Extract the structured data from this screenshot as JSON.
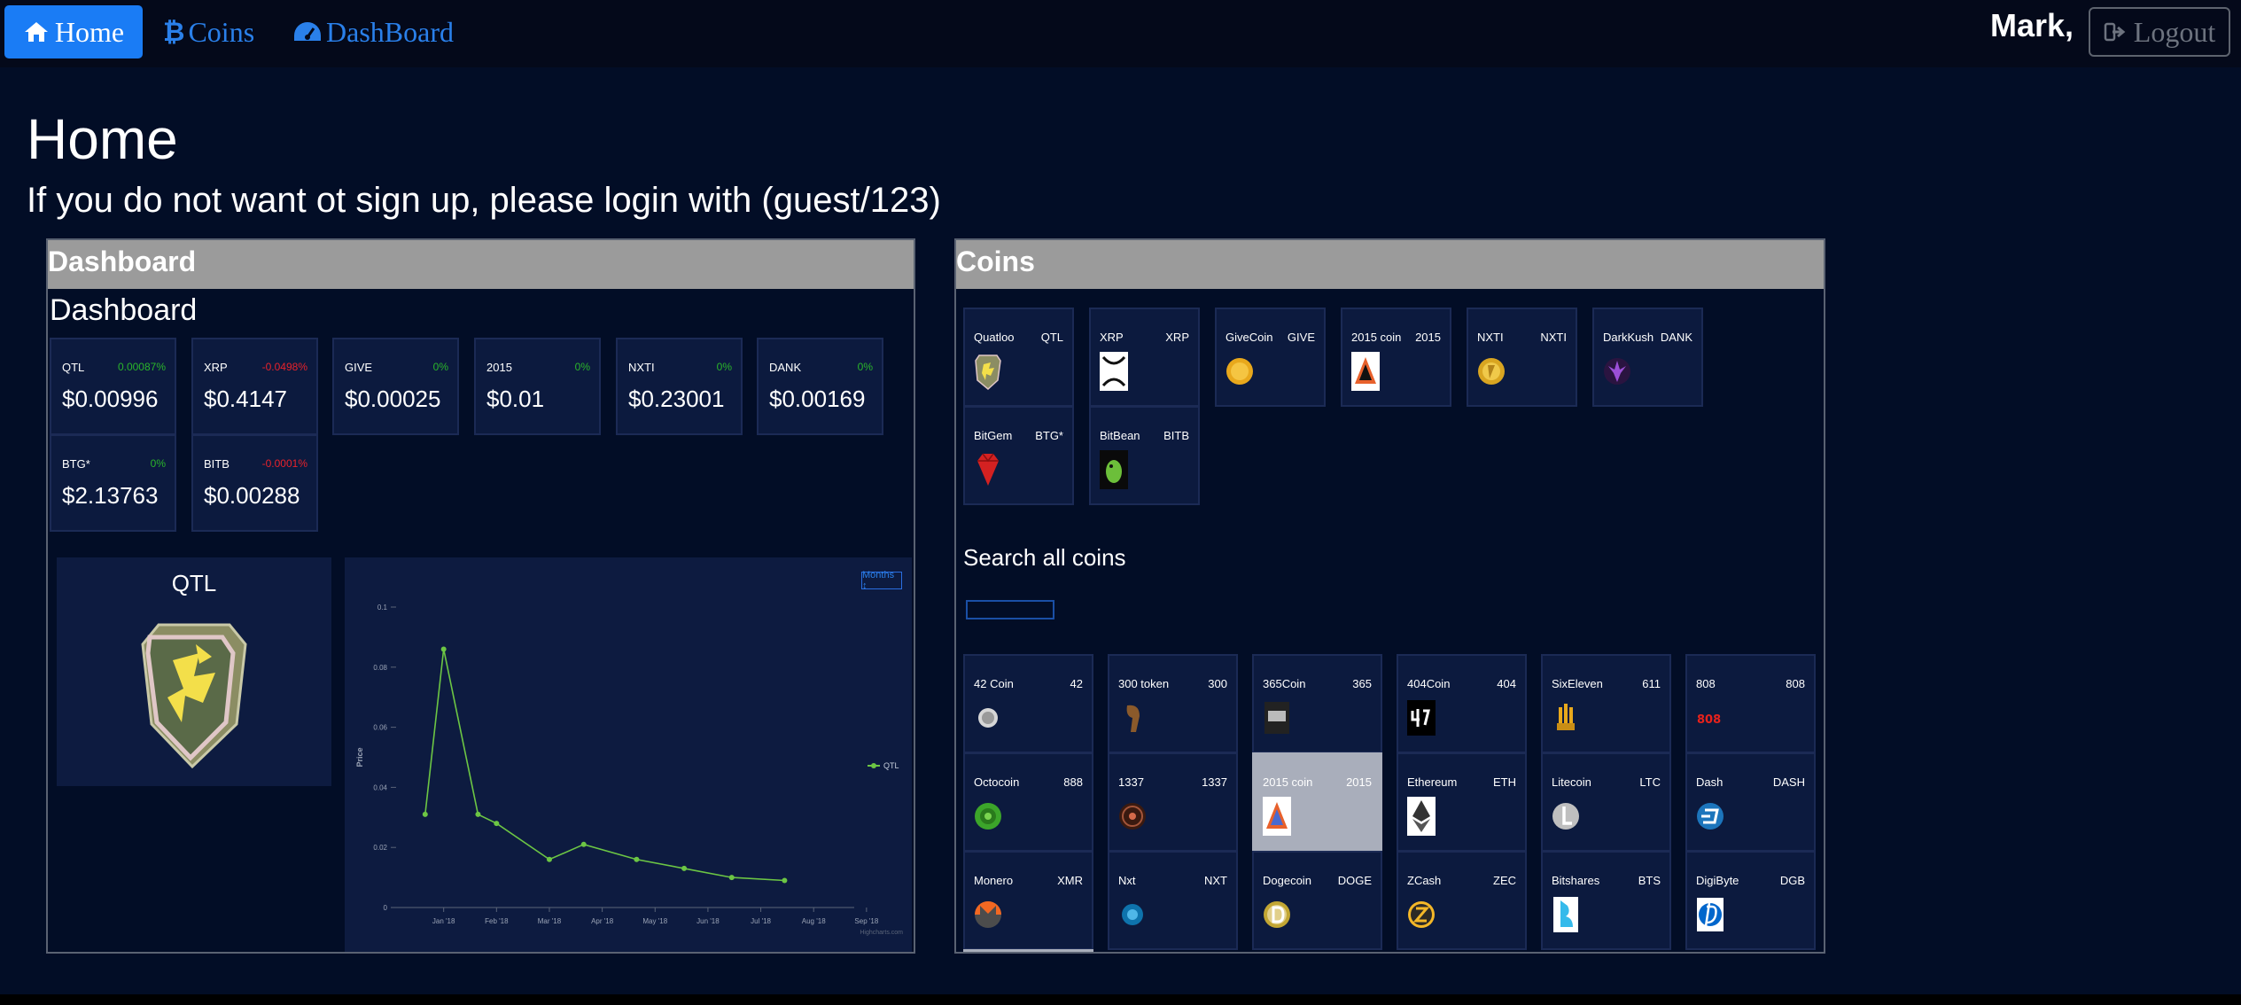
{
  "nav": {
    "home": "Home",
    "coins": "Coins",
    "dashboard": "DashBoard",
    "user": "Mark,",
    "logout": "Logout"
  },
  "page": {
    "title": "Home",
    "subtitle": "If you do not want ot sign up, please login with (guest/123)"
  },
  "dashboard_panel": {
    "header": "Dashboard",
    "subtitle": "Dashboard",
    "cards": [
      {
        "symbol": "QTL",
        "change": "0.00087%",
        "price": "$0.00996",
        "trend": "up"
      },
      {
        "symbol": "XRP",
        "change": "-0.0498%",
        "price": "$0.4147",
        "trend": "down"
      },
      {
        "symbol": "GIVE",
        "change": "0%",
        "price": "$0.00025",
        "trend": "up"
      },
      {
        "symbol": "2015",
        "change": "0%",
        "price": "$0.01",
        "trend": "up"
      },
      {
        "symbol": "NXTI",
        "change": "0%",
        "price": "$0.23001",
        "trend": "up"
      },
      {
        "symbol": "DANK",
        "change": "0%",
        "price": "$0.00169",
        "trend": "up"
      },
      {
        "symbol": "BTG*",
        "change": "0%",
        "price": "$2.13763",
        "trend": "up"
      },
      {
        "symbol": "BITB",
        "change": "-0.0001%",
        "price": "$0.00288",
        "trend": "down"
      }
    ],
    "selected_coin": "QTL",
    "months_button": "Months ↕"
  },
  "chart_data": {
    "type": "line",
    "x": [
      "Jan '18",
      "Feb '18",
      "Mar '18",
      "Apr '18",
      "May '18",
      "Jun '18",
      "Jul '18",
      "Aug '18",
      "Sep '18"
    ],
    "series": [
      {
        "name": "QTL",
        "x": [
          0.0,
          0.35,
          1.0,
          1.35,
          2.35,
          3.0,
          4.0,
          4.9,
          5.8,
          6.8
        ],
        "values": [
          0.031,
          0.086,
          0.031,
          0.028,
          0.016,
          0.021,
          0.016,
          0.013,
          0.01,
          0.009
        ]
      }
    ],
    "ylabel": "Price",
    "yticks": [
      "0",
      "0.02",
      "0.04",
      "0.06",
      "0.08",
      "0.1"
    ],
    "ylim": [
      0,
      0.1
    ],
    "legend": "right",
    "credit": "Highcharts.com",
    "color": "#6cc644"
  },
  "coins_panel": {
    "header": "Coins",
    "favorites": [
      {
        "name": "Quatloo",
        "symbol": "QTL",
        "icon": "quatloo-icon"
      },
      {
        "name": "XRP",
        "symbol": "XRP",
        "icon": "xrp-icon"
      },
      {
        "name": "GiveCoin",
        "symbol": "GIVE",
        "icon": "givecoin-icon"
      },
      {
        "name": "2015 coin",
        "symbol": "2015",
        "icon": "2015-coin-icon"
      },
      {
        "name": "NXTI",
        "symbol": "NXTI",
        "icon": "nxti-icon"
      },
      {
        "name": "DarkKush",
        "symbol": "DANK",
        "icon": "darkkush-icon"
      },
      {
        "name": "BitGem",
        "symbol": "BTG*",
        "icon": "bitgem-icon"
      },
      {
        "name": "BitBean",
        "symbol": "BITB",
        "icon": "bitbean-icon"
      }
    ],
    "search_label": "Search all coins",
    "search_value": "",
    "all": [
      {
        "name": "42 Coin",
        "symbol": "42",
        "icon": "42coin-icon"
      },
      {
        "name": "300 token",
        "symbol": "300",
        "icon": "300token-icon"
      },
      {
        "name": "365Coin",
        "symbol": "365",
        "icon": "365coin-icon"
      },
      {
        "name": "404Coin",
        "symbol": "404",
        "icon": "404coin-icon"
      },
      {
        "name": "SixEleven",
        "symbol": "611",
        "icon": "sixeleven-icon"
      },
      {
        "name": "808",
        "symbol": "808",
        "icon": "808-icon"
      },
      {
        "name": "Octocoin",
        "symbol": "888",
        "icon": "octocoin-icon"
      },
      {
        "name": "1337",
        "symbol": "1337",
        "icon": "1337-icon"
      },
      {
        "name": "2015 coin",
        "symbol": "2015",
        "icon": "2015-coin-icon"
      },
      {
        "name": "Ethereum",
        "symbol": "ETH",
        "icon": "ethereum-icon"
      },
      {
        "name": "Litecoin",
        "symbol": "LTC",
        "icon": "litecoin-icon"
      },
      {
        "name": "Dash",
        "symbol": "DASH",
        "icon": "dash-icon"
      },
      {
        "name": "Monero",
        "symbol": "XMR",
        "icon": "monero-icon"
      },
      {
        "name": "Nxt",
        "symbol": "NXT",
        "icon": "nxt-icon"
      },
      {
        "name": "Dogecoin",
        "symbol": "DOGE",
        "icon": "dogecoin-icon"
      },
      {
        "name": "ZCash",
        "symbol": "ZEC",
        "icon": "zcash-icon"
      },
      {
        "name": "Bitshares",
        "symbol": "BTS",
        "icon": "bitshares-icon"
      },
      {
        "name": "DigiByte",
        "symbol": "DGB",
        "icon": "digibyte-icon"
      }
    ],
    "selected_symbol": "2015"
  }
}
